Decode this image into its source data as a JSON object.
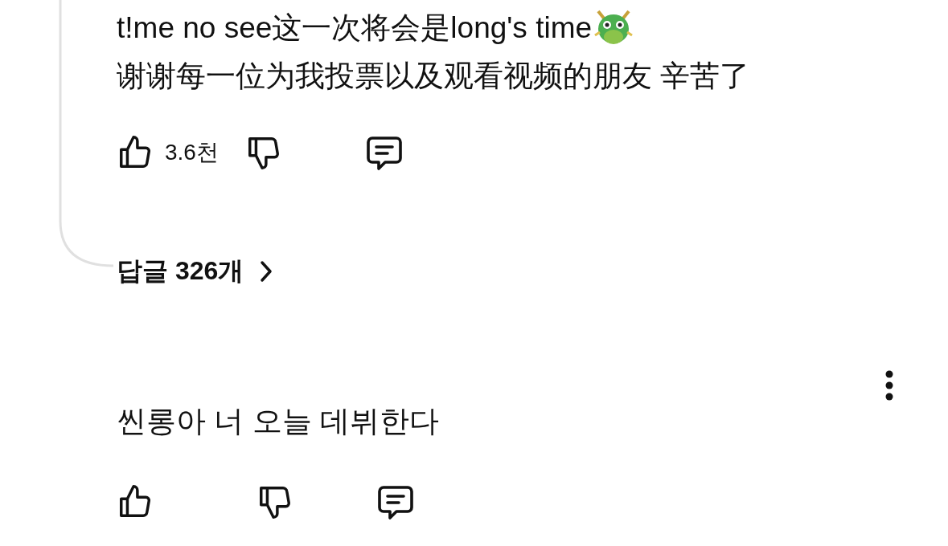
{
  "comments": [
    {
      "text_lines": [
        "t!me no see这一次将会是long's time",
        "谢谢每一位为我投票以及观看视频的朋友 辛苦了"
      ],
      "emoji_after_first_line": true,
      "likes": "3.6천",
      "thread_line": true,
      "replies": "답글 326개",
      "menu": false
    },
    {
      "text_lines": [
        "씬롱아 너 오늘 데뷔한다"
      ],
      "emoji_after_first_line": false,
      "thread_line": false,
      "menu": true
    }
  ]
}
